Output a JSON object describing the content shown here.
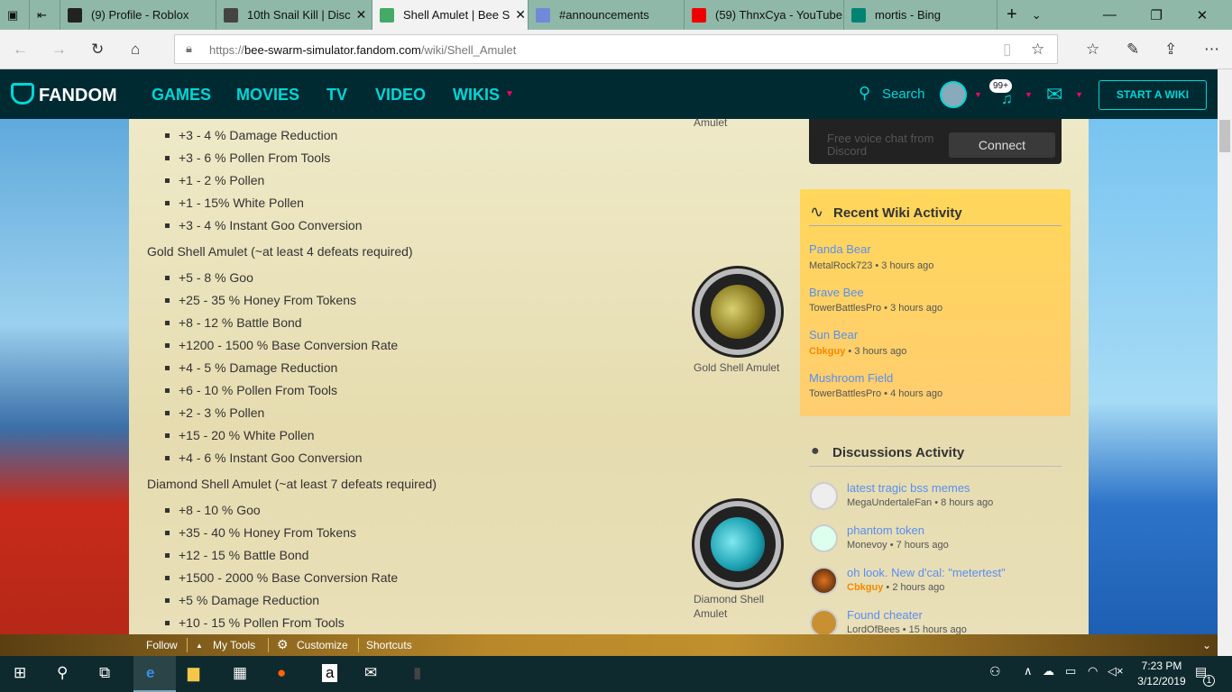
{
  "browser": {
    "tabs": [
      {
        "title": "(9) Profile - Roblox",
        "icon": "roblox-icon",
        "color": "#222"
      },
      {
        "title": "10th Snail Kill | Disc",
        "icon": "fandom-icon",
        "color": "#444"
      },
      {
        "title": "Shell Amulet | Bee S",
        "icon": "bee-swarm-icon",
        "color": "#4a6",
        "active": true
      },
      {
        "title": "#announcements",
        "icon": "discord-icon",
        "color": "#7289da"
      },
      {
        "title": "(59) ThnxCya - YouTube",
        "icon": "youtube-icon",
        "color": "#e00"
      },
      {
        "title": "mortis - Bing",
        "icon": "bing-icon",
        "color": "#008373"
      }
    ],
    "url_prefix": "https://",
    "url_domain": "bee-swarm-simulator.fandom.com",
    "url_path": "/wiki/Shell_Amulet"
  },
  "fandom": {
    "logo": "FANDOM",
    "nav": [
      "GAMES",
      "MOVIES",
      "TV",
      "VIDEO",
      "WIKIS"
    ],
    "search": "Search",
    "notifications": "99+",
    "start_wiki": "START A WIKI",
    "accent": "#00d6d6"
  },
  "article": {
    "top_caption": "Amulet",
    "silver_tail": [
      "+3 - 4 % Damage Reduction",
      "+3 - 6 % Pollen From Tools",
      "+1 - 2 % Pollen",
      "+1 - 15% White Pollen",
      "+3 - 4 % Instant Goo Conversion"
    ],
    "gold": {
      "heading": "Gold Shell Amulet (~at least 4 defeats required)",
      "caption": "Gold Shell Amulet",
      "items": [
        "+5 - 8 % Goo",
        "+25 - 35 % Honey From Tokens",
        "+8 - 12 % Battle Bond",
        "+1200 - 1500 % Base Conversion Rate",
        "+4 - 5 % Damage Reduction",
        "+6 - 10 % Pollen From Tools",
        "+2 - 3 % Pollen",
        "+15 - 20 % White Pollen",
        "+4 - 6 % Instant Goo Conversion"
      ]
    },
    "diamond": {
      "heading": "Diamond Shell Amulet (~at least 7 defeats required)",
      "caption": "Diamond Shell Amulet",
      "items": [
        "+8 - 10 % Goo",
        "+35 - 40 % Honey From Tokens",
        "+12 - 15 % Battle Bond",
        "+1500 - 2000 % Base Conversion Rate",
        "+5 % Damage Reduction",
        "+10 - 15 % Pollen From Tools"
      ]
    }
  },
  "discord": {
    "text": "Free voice chat from Discord",
    "connect": "Connect"
  },
  "recent": {
    "title": "Recent Wiki Activity",
    "items": [
      {
        "page": "Panda Bear",
        "user": "MetalRock723",
        "time": "• 3 hours ago"
      },
      {
        "page": "Brave Bee",
        "user": "TowerBattlesPro",
        "time": "• 3 hours ago"
      },
      {
        "page": "Sun Bear",
        "user": "Cbkguy",
        "time": "• 3 hours ago",
        "admin": true
      },
      {
        "page": "Mushroom Field",
        "user": "TowerBattlesPro",
        "time": "• 4 hours ago"
      }
    ]
  },
  "discussions": {
    "title": "Discussions Activity",
    "items": [
      {
        "title": "latest tragic bss memes",
        "user": "MegaUndertaleFan",
        "time": "• 8 hours ago",
        "avatar": "#eee"
      },
      {
        "title": "phantom token",
        "user": "Monevoy",
        "time": "• 7 hours ago",
        "avatar": "#dfe"
      },
      {
        "title": "oh look. New d'cal: \"metertest\"",
        "user": "Cbkguy",
        "time": "• 2 hours ago",
        "avatar": "#5a3010"
      },
      {
        "title": "Found cheater",
        "user": "LordOfBees",
        "time": "• 15 hours ago",
        "avatar": "#c89030"
      }
    ]
  },
  "toolbar": {
    "follow": "Follow",
    "my_tools": "My Tools",
    "customize": "Customize",
    "shortcuts": "Shortcuts"
  },
  "taskbar": {
    "time": "7:23 PM",
    "date": "3/12/2019",
    "notifications": "1"
  }
}
